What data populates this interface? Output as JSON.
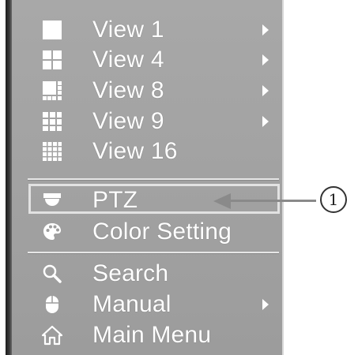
{
  "menu": {
    "items": [
      {
        "label": "View 1",
        "icon": "single-square-icon",
        "submenu": true
      },
      {
        "label": "View 4",
        "icon": "grid-2x2-icon",
        "submenu": true
      },
      {
        "label": "View 8",
        "icon": "grid-8-icon",
        "submenu": true
      },
      {
        "label": "View 9",
        "icon": "grid-3x3-icon",
        "submenu": true
      },
      {
        "label": "View 16",
        "icon": "grid-4x4-icon",
        "submenu": false
      },
      {
        "label": "PTZ",
        "icon": "ptz-camera-icon",
        "submenu": false
      },
      {
        "label": "Color Setting",
        "icon": "palette-icon",
        "submenu": false
      },
      {
        "label": "Search",
        "icon": "search-icon",
        "submenu": false
      },
      {
        "label": "Manual",
        "icon": "mouse-icon",
        "submenu": true
      },
      {
        "label": "Main Menu",
        "icon": "home-icon",
        "submenu": false
      }
    ]
  },
  "callout": {
    "number": "1",
    "target": "PTZ"
  },
  "colors": {
    "menu_bg": "#a3a3a3",
    "text": "#ffffff",
    "highlight": "#e2e2e2"
  }
}
